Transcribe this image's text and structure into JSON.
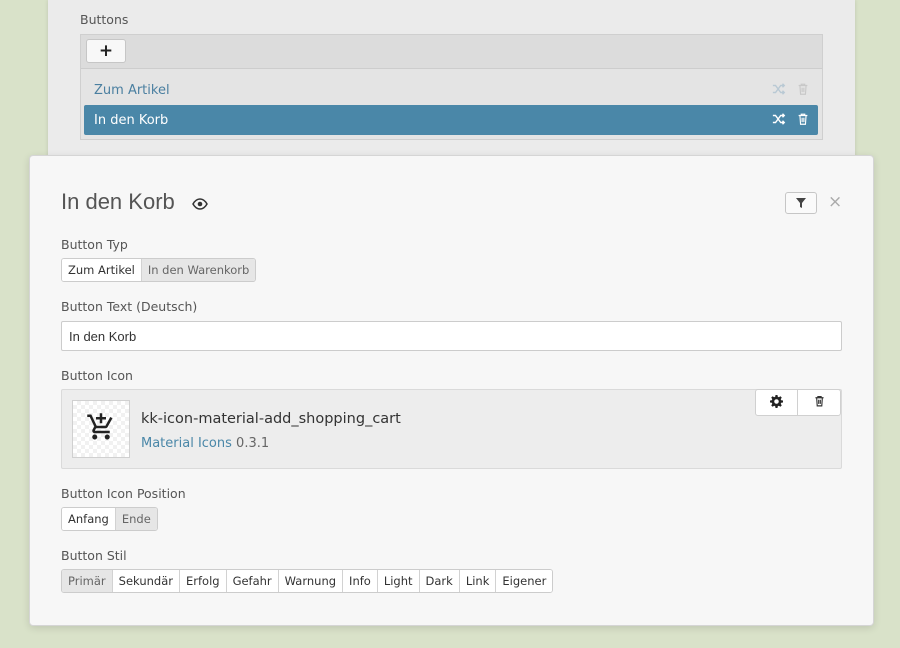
{
  "background_list": {
    "section_label": "Buttons",
    "add_label": "+",
    "items": [
      {
        "label": "Zum Artikel",
        "selected": false
      },
      {
        "label": "In den Korb",
        "selected": true
      }
    ]
  },
  "modal": {
    "title": "In den Korb",
    "button_type": {
      "label": "Button Typ",
      "options": [
        "Zum Artikel",
        "In den Warenkorb"
      ],
      "selected": "In den Warenkorb"
    },
    "button_text": {
      "label": "Button Text (Deutsch)",
      "value": "In den Korb"
    },
    "button_icon": {
      "label": "Button Icon",
      "icon_name": "kk-icon-material-add_shopping_cart",
      "library": "Material Icons",
      "version": "0.3.1"
    },
    "icon_position": {
      "label": "Button Icon Position",
      "options": [
        "Anfang",
        "Ende"
      ],
      "selected": "Ende"
    },
    "button_style": {
      "label": "Button Stil",
      "options": [
        "Primär",
        "Sekundär",
        "Erfolg",
        "Gefahr",
        "Warnung",
        "Info",
        "Light",
        "Dark",
        "Link",
        "Eigener"
      ],
      "selected": "Primär"
    }
  },
  "colors": {
    "page_background": "#d9e2c9",
    "accent": "#4a87a8",
    "link": "#4a7fa0"
  }
}
